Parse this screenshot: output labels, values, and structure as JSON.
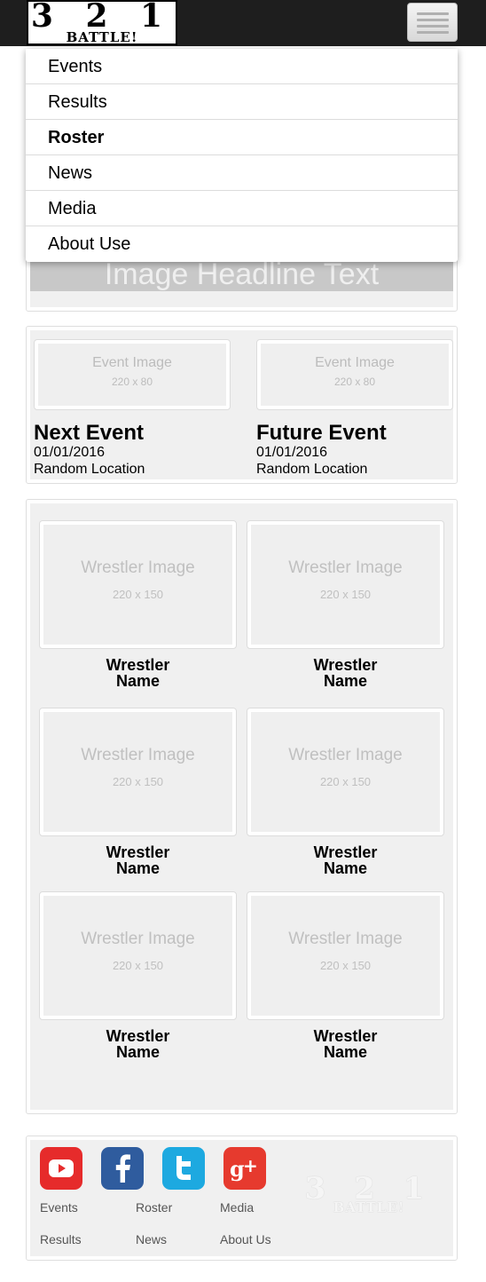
{
  "header": {
    "logo": {
      "numbers": "3 2 1",
      "word": "BATTLE!"
    }
  },
  "menu": {
    "items": [
      {
        "label": "Events",
        "active": false
      },
      {
        "label": "Results",
        "active": false
      },
      {
        "label": "Roster",
        "active": true
      },
      {
        "label": "News",
        "active": false
      },
      {
        "label": "Media",
        "active": false
      },
      {
        "label": "About Use",
        "active": false
      }
    ]
  },
  "headline": {
    "text": "Image Headline Text"
  },
  "events": [
    {
      "image_label": "Event Image",
      "image_size": "220 x 80",
      "title": "Next Event",
      "date": "01/01/2016",
      "location": "Random Location"
    },
    {
      "image_label": "Event Image",
      "image_size": "220 x 80",
      "title": "Future Event",
      "date": "01/01/2016",
      "location": "Random Location"
    }
  ],
  "roster": {
    "wrestlers": [
      {
        "image_label": "Wrestler Image",
        "image_size": "220 x 150",
        "name": "Wrestler Name"
      },
      {
        "image_label": "Wrestler Image",
        "image_size": "220 x 150",
        "name": "Wrestler Name"
      },
      {
        "image_label": "Wrestler Image",
        "image_size": "220 x 150",
        "name": "Wrestler Name"
      },
      {
        "image_label": "Wrestler Image",
        "image_size": "220 x 150",
        "name": "Wrestler Name"
      },
      {
        "image_label": "Wrestler Image",
        "image_size": "220 x 150",
        "name": "Wrestler Name"
      },
      {
        "image_label": "Wrestler Image",
        "image_size": "220 x 150",
        "name": "Wrestler Name"
      }
    ]
  },
  "footer": {
    "social": [
      {
        "icon": "youtube-icon",
        "color": "#e62b2b"
      },
      {
        "icon": "facebook-icon",
        "color": "#2f5c9e"
      },
      {
        "icon": "twitter-icon",
        "color": "#1da9e0"
      },
      {
        "icon": "google-plus-icon",
        "color": "#e63a2e"
      }
    ],
    "links_row1": [
      "Events",
      "Roster",
      "Media"
    ],
    "links_row2": [
      "Results",
      "News",
      "About Us"
    ],
    "watermark": {
      "numbers": "3 2 1",
      "word": "BATTLE!"
    }
  }
}
